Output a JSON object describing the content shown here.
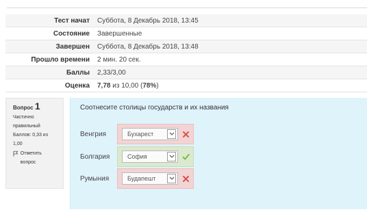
{
  "summary": [
    {
      "label": "Тест начат",
      "value": "Суббота, 8 Декабрь 2018, 13:45"
    },
    {
      "label": "Состояние",
      "value": "Завершенные"
    },
    {
      "label": "Завершен",
      "value": "Суббота, 8 Декабрь 2018, 13:48"
    },
    {
      "label": "Прошло времени",
      "value": "2 мин. 20 сек."
    },
    {
      "label": "Баллы",
      "value": "2,33/3,00"
    }
  ],
  "grade": {
    "label": "Оценка",
    "score": "7,78",
    "middle": " из 10,00 (",
    "percent": "78%",
    "suffix": ")"
  },
  "question": {
    "label": "Вопрос",
    "number": "1",
    "status": "Частично правильный",
    "points": "Баллов: 0,33 из 1,00",
    "flag_label": "Отметить вопрос",
    "text": "Соотнесите столицы государств и их названия",
    "answers": [
      {
        "country": "Венгрия",
        "selected": "Бухарест",
        "correct": false,
        "mark_icon": "cross-icon"
      },
      {
        "country": "Болгария",
        "selected": "София",
        "correct": true,
        "mark_icon": "check-icon"
      },
      {
        "country": "Румыния",
        "selected": "Будапешт",
        "correct": false,
        "mark_icon": "cross-icon"
      }
    ]
  },
  "colors": {
    "incorrect_background": "#f2d4d4",
    "correct_background": "#dbe9cf",
    "question_background": "#dff3fb",
    "incorrect_mark": "#d9534f",
    "correct_mark": "#6dbb3c"
  },
  "icons": {
    "flag": "flag-icon",
    "dropdown": "chevron-down-icon"
  }
}
